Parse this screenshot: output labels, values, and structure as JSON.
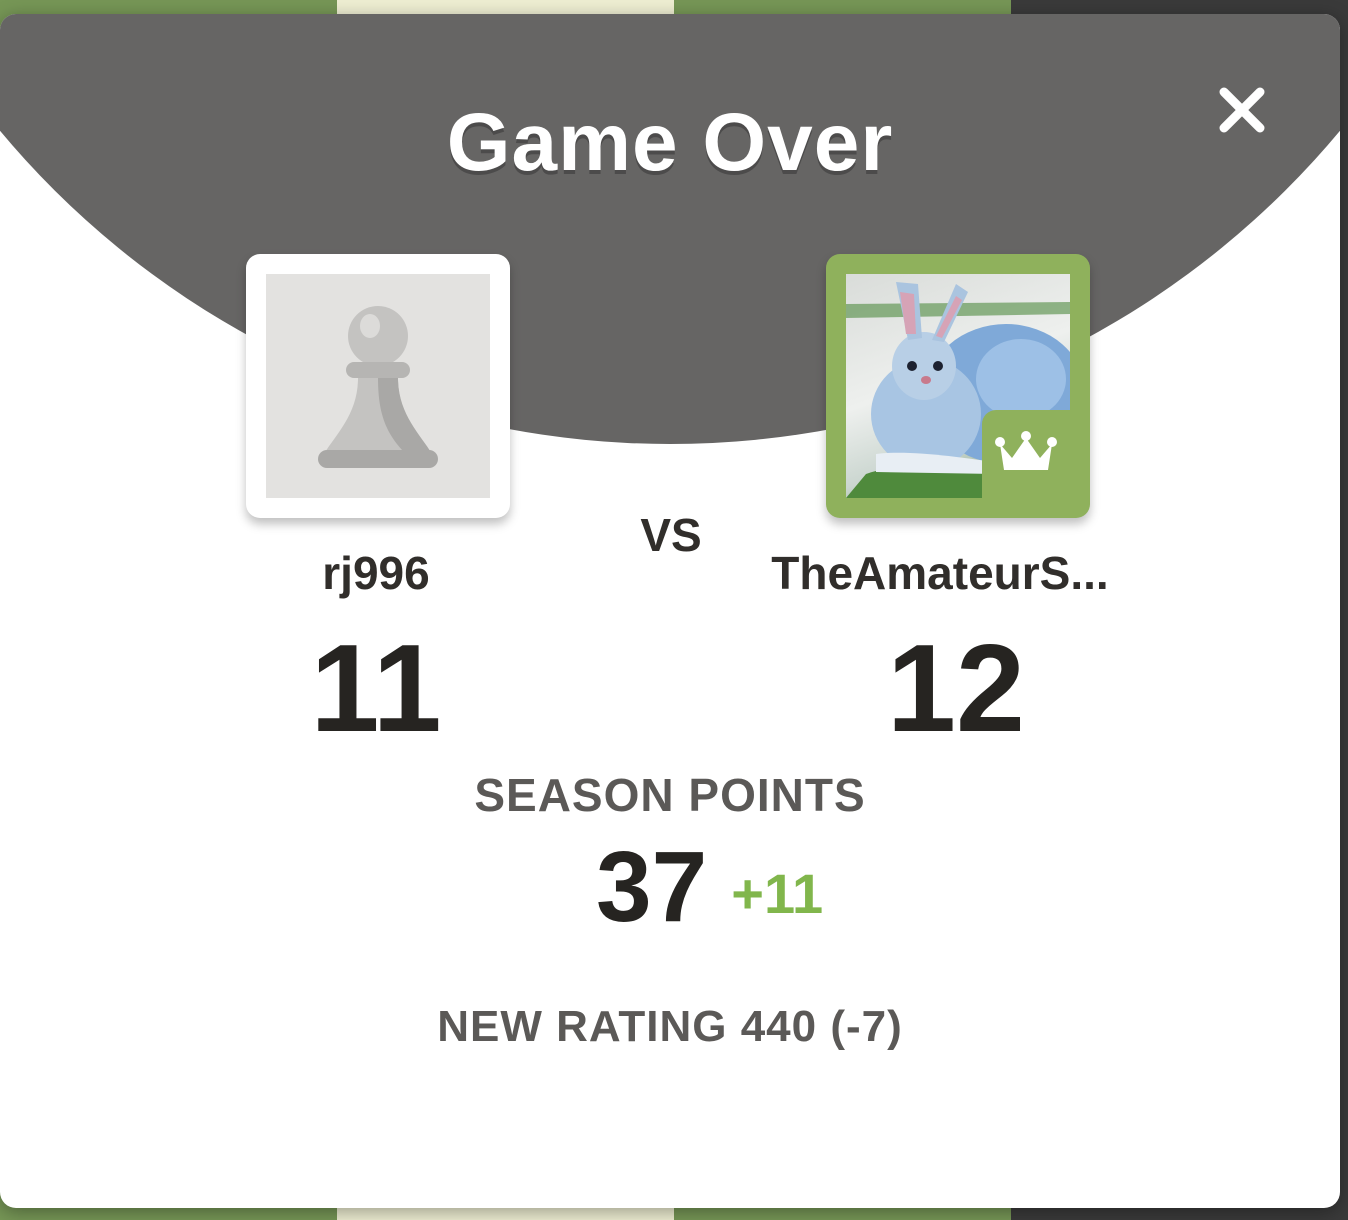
{
  "modal": {
    "title": "Game Over",
    "close_icon": "close-icon"
  },
  "players": {
    "left": {
      "username": "rj996",
      "score": "11",
      "avatar_icon": "pawn-icon"
    },
    "right": {
      "username": "TheAmateurS...",
      "score": "12",
      "avatar_icon": "rabbit-avatar",
      "badge_icon": "crown-icon"
    },
    "vs_label": "VS"
  },
  "season": {
    "label": "SEASON POINTS",
    "points": "37",
    "delta": "+11"
  },
  "rating": {
    "text": "NEW RATING 440 (-7)"
  },
  "colors": {
    "header": "#666564",
    "accent_green": "#81b64c",
    "badge_green": "#8fb15c"
  }
}
